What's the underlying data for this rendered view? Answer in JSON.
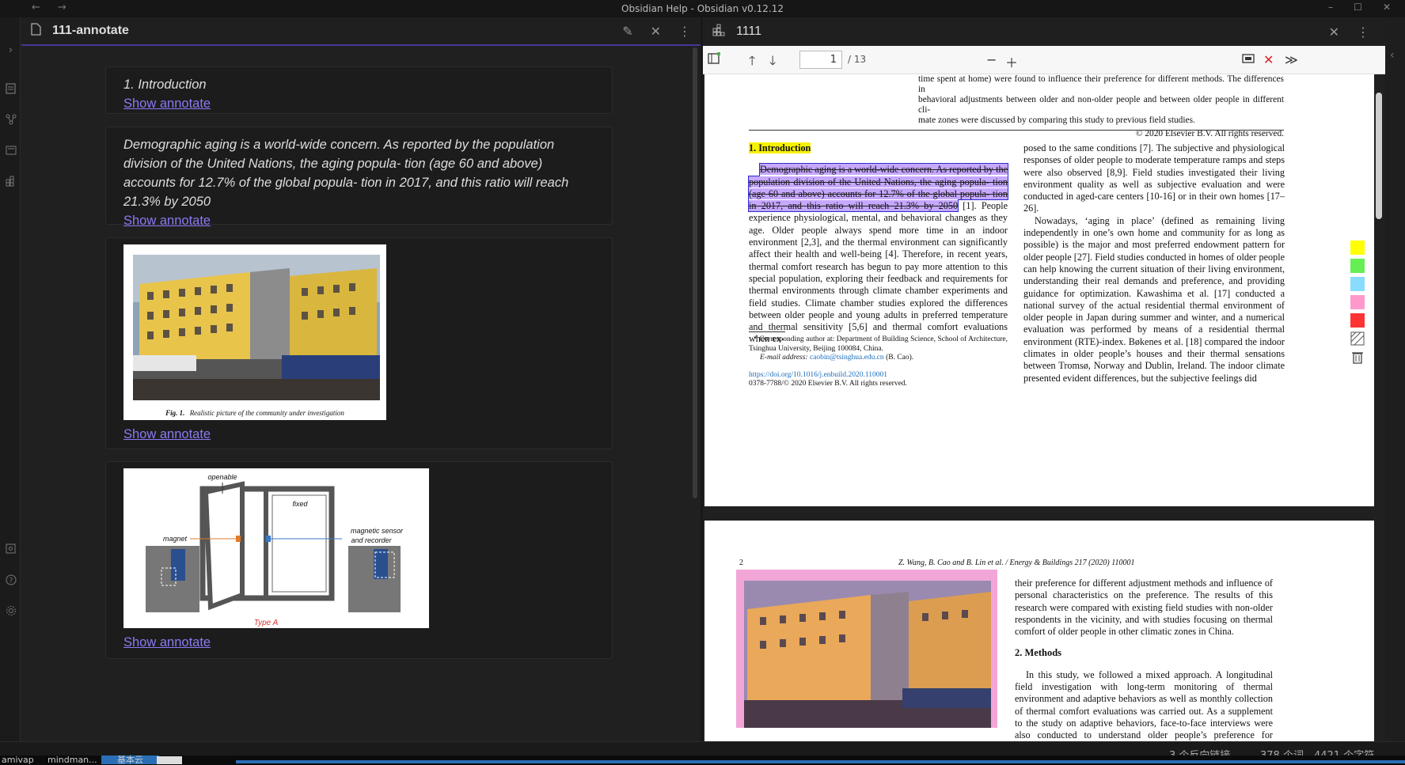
{
  "window": {
    "title": "Obsidian Help - Obsidian v0.12.12",
    "nav_back": "←",
    "nav_forward": "→",
    "minimize": "–",
    "maximize": "☐",
    "close": "✕"
  },
  "left_tab": {
    "title": "111-annotate"
  },
  "cards": [
    {
      "text": "1. Introduction",
      "link": "Show annotate"
    },
    {
      "text": "Demographic aging is a world-wide concern. As reported by the population division of the United Nations, the aging popula- tion (age 60 and above) accounts for 12.7% of the global popula- tion in 2017, and this ratio will reach 21.3% by 2050",
      "link": "Show annotate"
    },
    {
      "caption_label": "Fig. 1.",
      "caption": "Realistic picture of the community under investigation",
      "link": "Show annotate"
    },
    {
      "labels": {
        "openable": "openable",
        "fixed": "fixed",
        "magnet": "magnet",
        "sensor1": "magnetic sensor",
        "sensor2": "and recorder",
        "type": "Type A"
      },
      "link": "Show annotate"
    }
  ],
  "right_tab": {
    "title": "1111"
  },
  "pdf_toolbar": {
    "page_value": "1",
    "page_total": "/ 13"
  },
  "pdf_page1": {
    "abstract_tail_1": "time spent at home) were found to influence their preference for different methods. The differences in",
    "abstract_tail_2": "behavioral adjustments between older and non-older people and between older people in different cli-",
    "abstract_tail_3": "mate zones were discussed by comparing this study to previous field studies.",
    "copyright": "© 2020 Elsevier B.V. All rights reserved.",
    "heading": "1. Introduction",
    "highlight": "Demographic aging is a world-wide concern. As reported by the population division of the United Nations, the aging popula- tion (age 60 and above) accounts for 12.7% of the global popula- tion in 2017, and this ratio will reach 21.3% by 2050",
    "col1_rest": " [1]. People experience physiological, mental, and behavioral changes as they age. Older people always spend more time in an indoor environment [2,3], and the thermal environment can significantly affect their health and well-being [4]. Therefore, in recent years, thermal comfort research has begun to pay more attention to this special population, exploring their feedback and requirements for thermal environments through climate chamber experiments and field studies. Climate chamber studies explored the differences between older people and young adults in preferred temperature and thermal sensitivity [5,6] and thermal comfort evaluations when ex-",
    "col2_p1": "posed to the same conditions [7]. The subjective and physiological responses of older people to moderate temperature ramps and steps were also observed [8,9]. Field studies investigated their living environment quality as well as subjective evaluation and were conducted in aged-care centers [10-16] or in their own homes [17–26].",
    "col2_p2": "Nowadays, ‘aging in place’ (defined as remaining living independently in one’s own home and community for as long as possible) is the major and most preferred endowment pattern for older people [27]. Field studies conducted in homes of older people can help knowing the current situation of their living environment, understanding their real demands and preference, and providing guidance for optimization. Kawashima et al. [17] conducted a national survey of the actual residential thermal environment of older people in Japan during summer and winter, and a numerical evaluation was performed by means of a residential thermal environment (RTE)-index. Bøkenes et al. [18] compared the indoor climates in older people’s houses and their thermal sensations between Tromsø, Norway and Dublin, Ireland. The indoor climate presented evident differences, but the subjective feelings did",
    "footnote_1": "* Corresponding author at: Department of Building Science, School of Architecture, Tsinghua University, Beijing 100084, China.",
    "footnote_2_label": "E-mail address:",
    "footnote_2_email": "caobin@tsinghua.edu.cn",
    "footnote_2_tail": "(B. Cao).",
    "doi": "https://doi.org/10.1016/j.enbuild.2020.110001",
    "issn": "0378-7788/© 2020 Elsevier B.V. All rights reserved."
  },
  "pdf_page2": {
    "page_no": "2",
    "running_head": "Z. Wang, B. Cao and B. Lin et al. / Energy & Buildings 217 (2020) 110001",
    "p1": "their preference for different adjustment methods and influence of personal characteristics on the preference. The results of this research were compared with existing field studies with non-older respondents in the vicinity, and with studies focusing on thermal comfort of older people in other climatic zones in China.",
    "heading": "2. Methods",
    "p2": "In this study, we followed a mixed approach. A longitudinal field investigation with long-term monitoring of thermal environment and adaptive behaviors as well as monthly collection of thermal comfort evaluations was carried out. As a supplement to the study on adaptive behaviors, face-to-face interviews were also conducted to understand older people’s preference for behavioral ad-"
  },
  "palette_colors": [
    "#ffff00",
    "#66ee55",
    "#88ddff",
    "#ff99cc",
    "#ff3333"
  ],
  "status": {
    "backlinks": "3 个反向链接",
    "words": "378 个词",
    "chars": "4421 个字符"
  },
  "taskbar": {
    "item1": "amivap",
    "item2": "mindman...",
    "item3": "基本云"
  }
}
